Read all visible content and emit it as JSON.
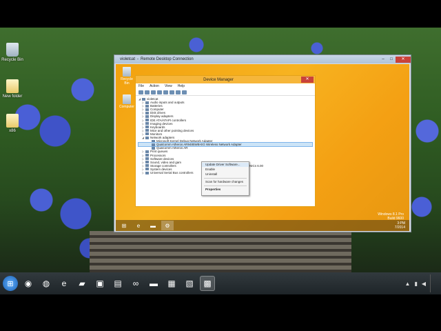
{
  "host": {
    "desktop_icons": [
      {
        "label": "Recycle Bin",
        "icon": "recycle-bin-icon"
      },
      {
        "label": "New folder",
        "icon": "folder-icon"
      },
      {
        "label": "x86",
        "icon": "folder-icon"
      }
    ],
    "taskbar": {
      "apps": [
        {
          "name": "chrome",
          "glyph": "◉"
        },
        {
          "name": "firefox",
          "glyph": "◍"
        },
        {
          "name": "ie",
          "glyph": "e"
        },
        {
          "name": "app4",
          "glyph": "▰"
        },
        {
          "name": "app5",
          "glyph": "▣"
        },
        {
          "name": "app6",
          "glyph": "▤"
        },
        {
          "name": "app7",
          "glyph": "∞"
        },
        {
          "name": "explorer",
          "glyph": "▬"
        },
        {
          "name": "app9",
          "glyph": "▦"
        },
        {
          "name": "app10",
          "glyph": "▧"
        },
        {
          "name": "remote-desktop",
          "glyph": "▩"
        }
      ]
    }
  },
  "rdp": {
    "host_label": "violetcat",
    "separator": "-",
    "title": "Remote Desktop Connection",
    "minimize": "–",
    "maximize": "□",
    "close": "✕"
  },
  "remote": {
    "desktop_icons": [
      {
        "label": "Recycle Bin"
      },
      {
        "label": "Computer"
      }
    ],
    "watermark": [
      "Windows 8.1 Pro",
      "Build 9600"
    ],
    "clock": [
      "3:PM",
      "7/2014"
    ],
    "taskbar_glyphs": [
      "⊞",
      "e",
      "▬",
      "⚙"
    ]
  },
  "device_manager": {
    "title": "Device Manager",
    "close": "✕",
    "menu": [
      "File",
      "Action",
      "View",
      "Help"
    ],
    "tree": [
      {
        "label": "violetcat",
        "level": "root",
        "exp": "◢"
      },
      {
        "label": "Audio inputs and outputs",
        "level": "l1",
        "exp": "▷"
      },
      {
        "label": "Batteries",
        "level": "l1",
        "exp": "▷"
      },
      {
        "label": "Computer",
        "level": "l1",
        "exp": "▷"
      },
      {
        "label": "Disk drives",
        "level": "l1",
        "exp": "▷"
      },
      {
        "label": "Display adapters",
        "level": "l1",
        "exp": "▷"
      },
      {
        "label": "IDE ATA/ATAPI controllers",
        "level": "l1",
        "exp": "▷"
      },
      {
        "label": "Imaging devices",
        "level": "l1",
        "exp": "▷"
      },
      {
        "label": "Keyboards",
        "level": "l1",
        "exp": "▷"
      },
      {
        "label": "Mice and other pointing devices",
        "level": "l1",
        "exp": "▷"
      },
      {
        "label": "Monitors",
        "level": "l1",
        "exp": "▷"
      },
      {
        "label": "Network adapters",
        "level": "l1",
        "exp": "◢"
      },
      {
        "label": "Microsoft Kernel Debug Network Adapter",
        "level": "l2",
        "exp": ""
      },
      {
        "label": "Qualcomm Atheros AR9485WB-EG Wireless Network Adapter",
        "level": "l2",
        "exp": "",
        "selected": true
      },
      {
        "label": "Qualcomm Atheros AR",
        "level": "l2",
        "exp": ""
      },
      {
        "label": "Print queues",
        "level": "l1",
        "exp": "▷"
      },
      {
        "label": "Processors",
        "level": "l1",
        "exp": "▷"
      },
      {
        "label": "Software devices",
        "level": "l1",
        "exp": "▷"
      },
      {
        "label": "Sound, video and gam",
        "level": "l1",
        "exp": "▷"
      },
      {
        "label": "Storage controllers",
        "level": "l1",
        "exp": "▷"
      },
      {
        "label": "System devices",
        "level": "l1",
        "exp": "▷"
      },
      {
        "label": "Universal Serial Bus controllers",
        "level": "l1",
        "exp": "▷"
      }
    ],
    "trailing_fragment": "NICs 6.00"
  },
  "context_menu": {
    "items": [
      {
        "label": "Update Driver Software...",
        "hover": true
      },
      {
        "label": "Enable"
      },
      {
        "label": "Uninstall"
      },
      {
        "sep": true
      },
      {
        "label": "Scan for hardware changes"
      },
      {
        "sep": true
      },
      {
        "label": "Properties",
        "bold": true
      }
    ]
  }
}
